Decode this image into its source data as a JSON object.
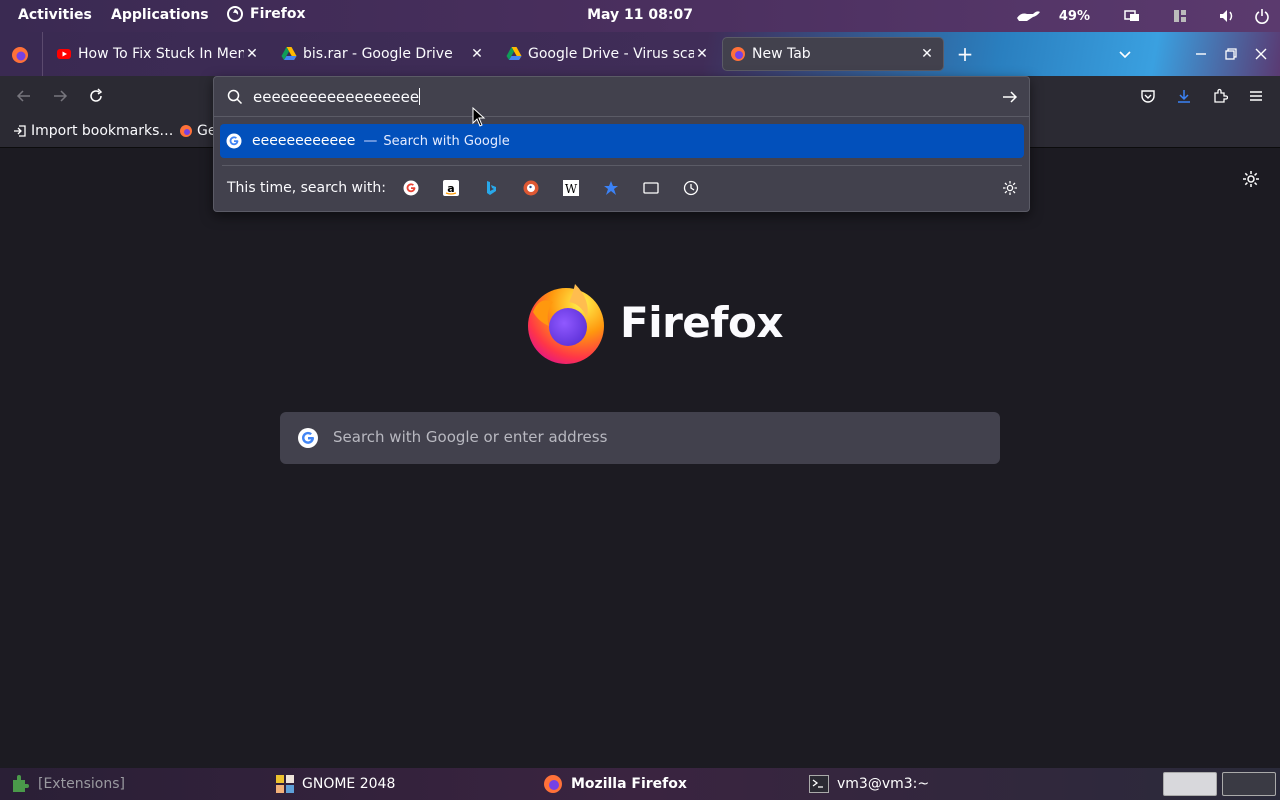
{
  "topbar": {
    "activities": "Activities",
    "applications": "Applications",
    "app_name": "Firefox",
    "clock": "May 11  08:07",
    "battery": "49%"
  },
  "tabs": [
    {
      "title": "How To Fix Stuck In Menu",
      "icon": "youtube-icon"
    },
    {
      "title": "bis.rar - Google Drive",
      "icon": "google-drive-icon"
    },
    {
      "title": "Google Drive - Virus scan",
      "icon": "google-drive-icon"
    },
    {
      "title": "New Tab",
      "icon": "firefox-icon",
      "active": true
    }
  ],
  "bookmarks": {
    "import": "Import bookmarks…",
    "getting_started": "Ge"
  },
  "urlbar": {
    "typed": "eeeeeeeeeeeeeeeeee",
    "suggestion_query": "eeeeeeeeeeee",
    "suggestion_dash": "—",
    "suggestion_action": "Search with Google",
    "oneoff_label": "This time, search with:",
    "engines": [
      "google-icon",
      "amazon-icon",
      "bing-icon",
      "duckduckgo-icon",
      "wikipedia-icon",
      "bookmarks-icon",
      "tabs-icon",
      "history-icon"
    ]
  },
  "newtab": {
    "brand": "Firefox",
    "search_placeholder": "Search with Google or enter address"
  },
  "taskbar": {
    "extensions": "[Extensions]",
    "gnome2048": "GNOME 2048",
    "firefox": "Mozilla Firefox",
    "terminal": "vm3@vm3:~"
  },
  "colors": {
    "accent": "#0250bb",
    "content_bg": "#1c1b22",
    "toolbar_bg": "#2b2a33",
    "panel_bg": "#42414d"
  }
}
